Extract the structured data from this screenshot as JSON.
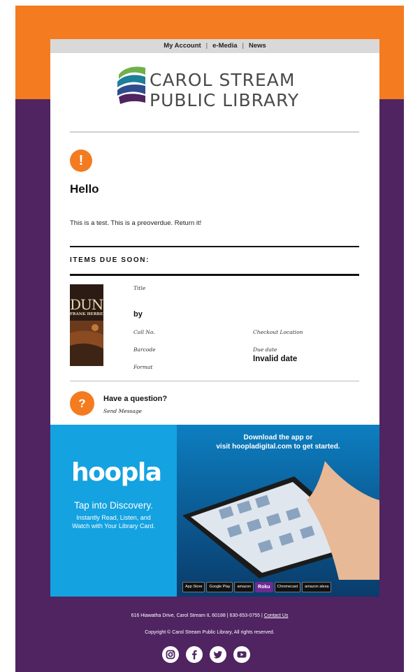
{
  "nav": {
    "items": [
      "My Account",
      "e-Media",
      "News"
    ],
    "separator": "|"
  },
  "logo": {
    "line1": "CAROL STREAM",
    "line2": "PUBLIC LIBRARY"
  },
  "notice": {
    "icon_glyph": "!",
    "greeting": "Hello",
    "message": "This is a test. This is a preoverdue. Return it!"
  },
  "items": {
    "section_title": "ITEMS DUE SOON:",
    "book": {
      "cover_title": "DUNE",
      "cover_author": "FRANK HERBERT",
      "title_label": "Title",
      "by_label": "by",
      "call_no_label": "Call No.",
      "barcode_label": "Barcode",
      "format_label": "Format",
      "checkout_location_label": "Checkout Location",
      "due_date_label": "Due date",
      "due_date_value": "Invalid date"
    }
  },
  "question": {
    "icon_glyph": "?",
    "title": "Have a question?",
    "link": "Send Message"
  },
  "banner": {
    "brand": "hoopla",
    "tagline": "Tap into Discovery.",
    "sub_line1": "Instantly Read, Listen, and",
    "sub_line2": "Watch with Your Library Card.",
    "cta_line1": "Download the app or",
    "cta_line2": "visit hoopladigital.com to get started.",
    "stores": [
      "App Store",
      "Google Play",
      "amazon",
      "Roku",
      "Chromecast",
      "amazon alexa"
    ]
  },
  "footer": {
    "address": "616 Hiawatha Drive, Carol Stream IL 60188 | 630-653-0755 |",
    "contact_link": "Contact Us",
    "copyright": "Copyright © Carol Stream Public Library, All rights reserved.",
    "social_icons": [
      "instagram-icon",
      "facebook-icon",
      "twitter-icon",
      "youtube-icon"
    ]
  },
  "colors": {
    "orange": "#f47b20",
    "purple": "#4f2461",
    "hoopla_blue": "#14a2e1"
  }
}
